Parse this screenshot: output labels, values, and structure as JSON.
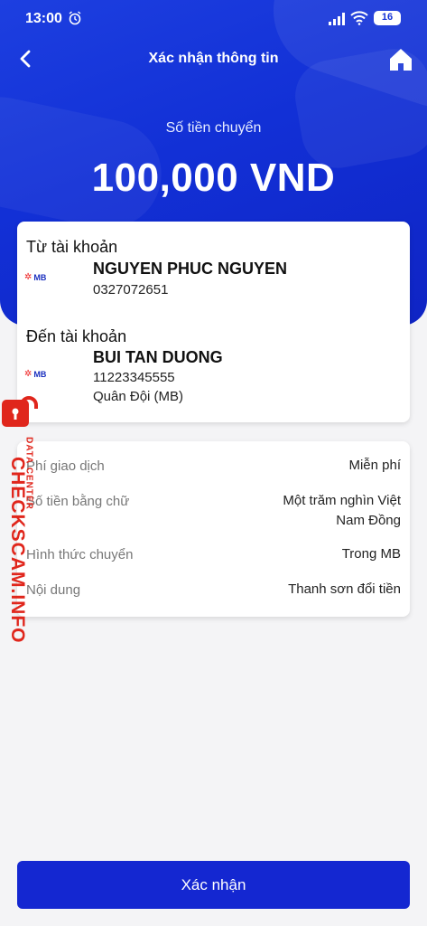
{
  "status": {
    "time": "13:00",
    "battery": "16"
  },
  "header": {
    "title": "Xác nhận thông tin"
  },
  "amount": {
    "label": "Số tiền chuyển",
    "value": "100,000 VND"
  },
  "from": {
    "label": "Từ tài khoản",
    "bank_logo": "MB",
    "name": "NGUYEN PHUC NGUYEN",
    "account": "0327072651"
  },
  "to": {
    "label": "Đến tài khoản",
    "bank_logo": "MB",
    "name": "BUI TAN DUONG",
    "account": "11223345555",
    "bank": "Quân Đội (MB)"
  },
  "details": [
    {
      "label": "Phí giao dịch",
      "value": "Miễn phí"
    },
    {
      "label": "Số tiền bằng chữ",
      "value_line1": "Một trăm nghìn Việt",
      "value_line2": "Nam Đồng"
    },
    {
      "label": "Hình thức chuyển",
      "value": "Trong MB"
    },
    {
      "label": "Nội dung",
      "value": "Thanh sơn đổi tiền"
    }
  ],
  "watermark": {
    "main": "CHECKSCAM.INFO",
    "sub": "DATA CENTER"
  },
  "confirm_label": "Xác nhận",
  "icons": {
    "back": "back-arrow-icon",
    "home": "home-icon"
  },
  "colors": {
    "primary": "#1427d1",
    "watermark": "#e0261c"
  }
}
